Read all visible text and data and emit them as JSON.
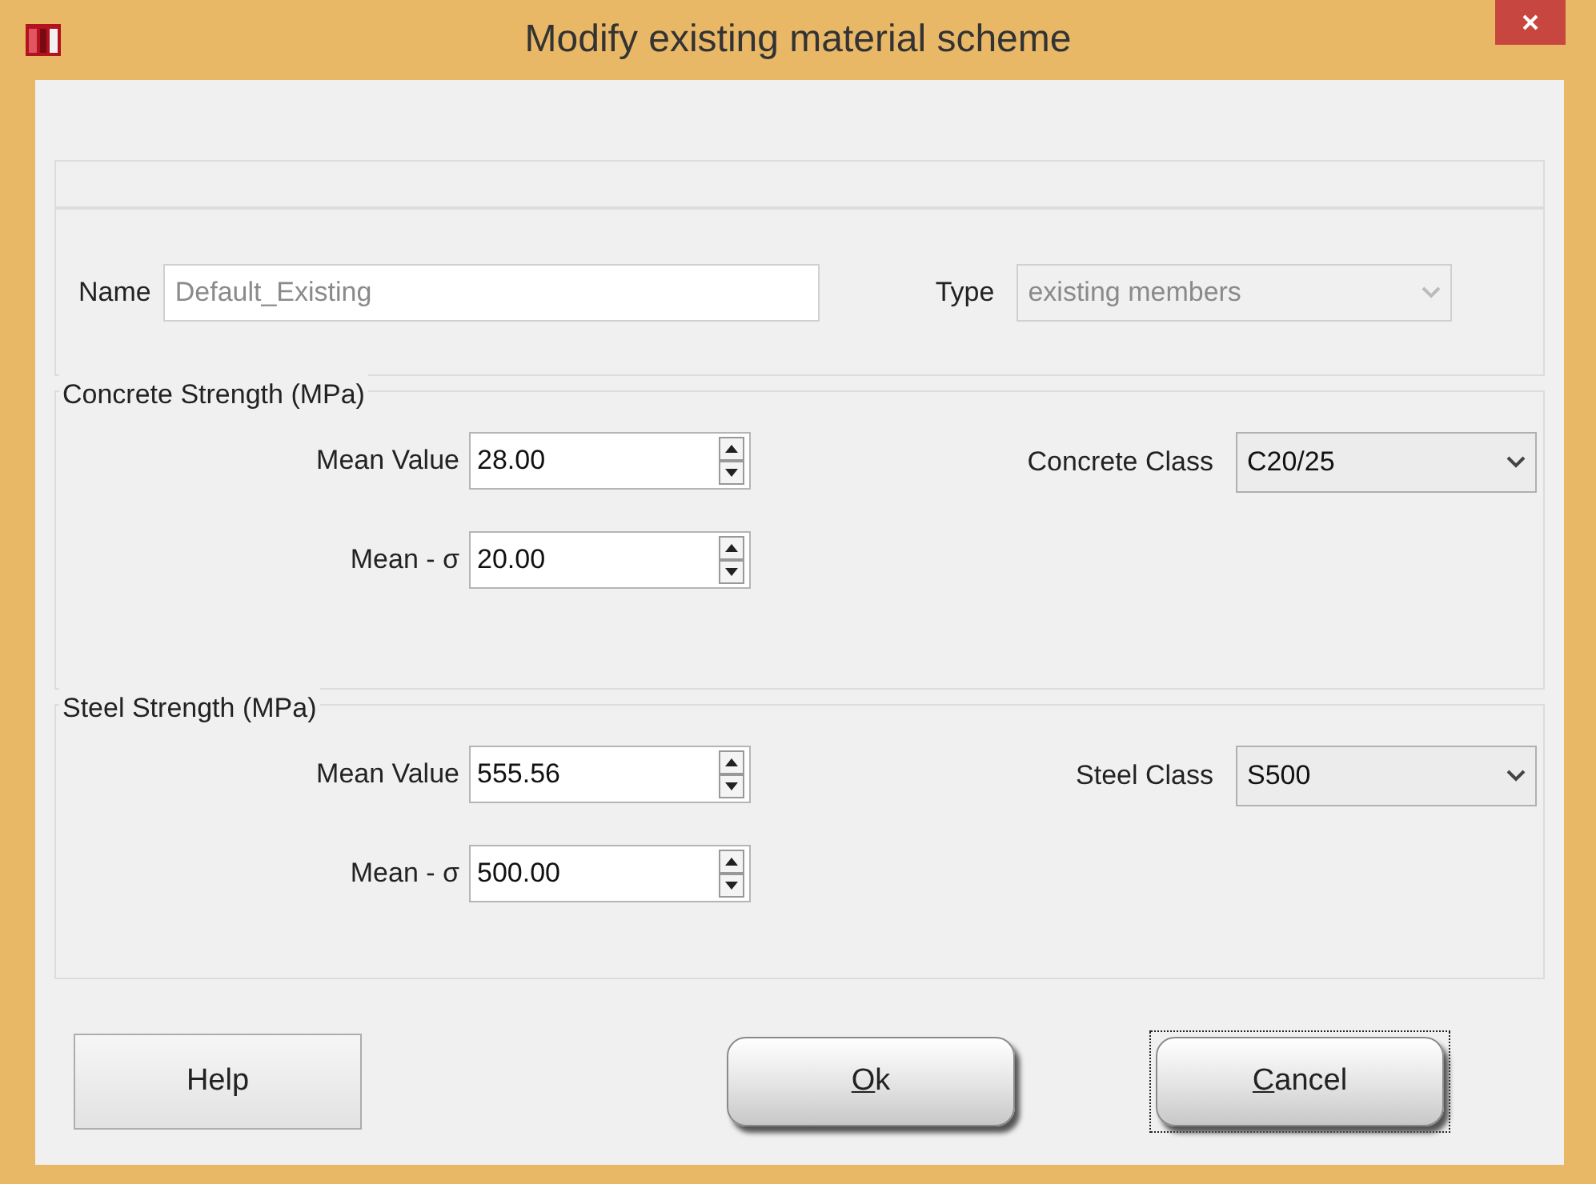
{
  "window": {
    "title": "Modify existing material scheme"
  },
  "general": {
    "name": {
      "label": "Name",
      "value": "Default_Existing",
      "disabled": true
    },
    "type": {
      "label": "Type",
      "value": "existing members",
      "disabled": true
    }
  },
  "groups": [
    {
      "title": "Concrete Strength (MPa)",
      "fields": [
        {
          "label": "Mean Value",
          "value": "28.00"
        },
        {
          "label": "Mean - σ",
          "value": "20.00"
        }
      ],
      "class": {
        "label": "Concrete Class",
        "value": "C20/25"
      }
    },
    {
      "title": "Steel Strength (MPa)",
      "fields": [
        {
          "label": "Mean Value",
          "value": "555.56"
        },
        {
          "label": "Mean - σ",
          "value": "500.00"
        }
      ],
      "class": {
        "label": "Steel Class",
        "value": "S500"
      }
    }
  ],
  "buttons": [
    {
      "kind": "flat",
      "rest": "Help",
      "focused": false
    },
    {
      "kind": "glossy",
      "mnemonic": "O",
      "rest": "k",
      "focused": false
    },
    {
      "kind": "glossy",
      "mnemonic": "C",
      "rest": "ancel",
      "focused": true
    }
  ]
}
